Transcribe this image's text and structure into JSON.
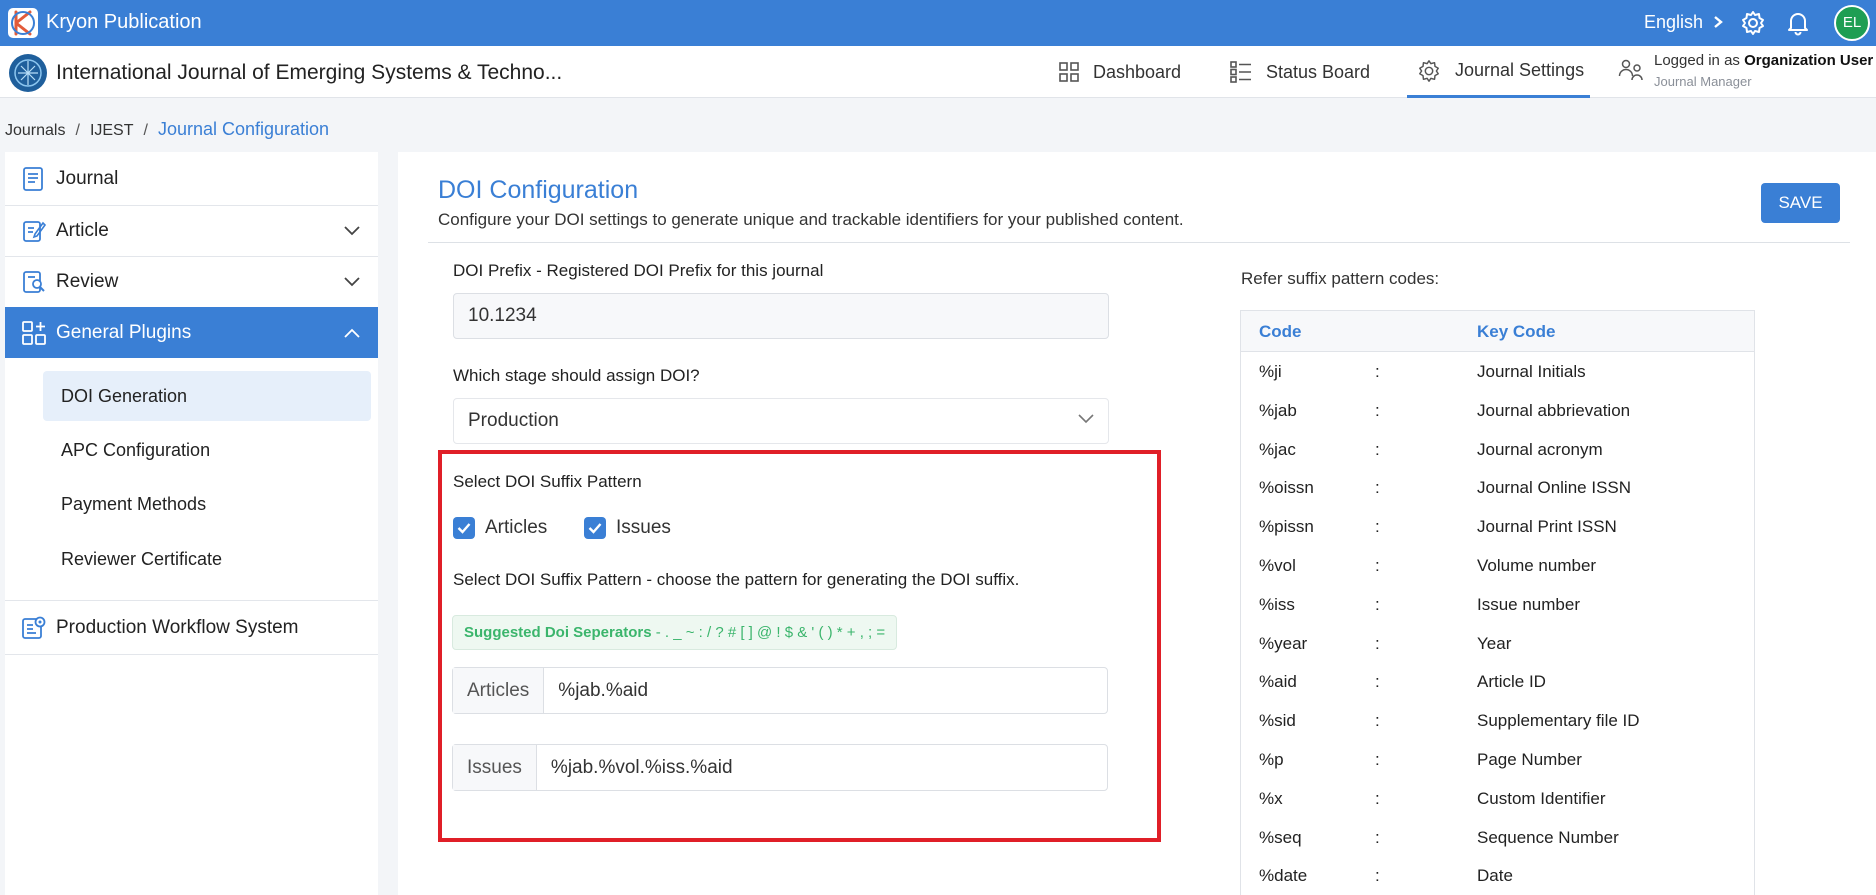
{
  "app": {
    "title": "Kryon Publication",
    "language": "English",
    "avatar_initials": "EL",
    "accent_color": "#3a7fd5"
  },
  "header": {
    "journal_title": "International Journal of Emerging Systems & Techno...",
    "nav": {
      "dashboard": "Dashboard",
      "status_board": "Status Board",
      "journal_settings": "Journal Settings"
    },
    "user": {
      "logged_prefix": "Logged in as",
      "logged_name": "Organization User",
      "role": "Journal Manager"
    }
  },
  "breadcrumb": {
    "journals": "Journals",
    "journal": "IJEST",
    "current": "Journal Configuration"
  },
  "sidebar": {
    "journal": "Journal",
    "article": "Article",
    "review": "Review",
    "general_plugins": "General Plugins",
    "sub": {
      "doi_generation": "DOI Generation",
      "apc_configuration": "APC Configuration",
      "payment_methods": "Payment Methods",
      "reviewer_certificate": "Reviewer Certificate"
    },
    "production": "Production Workflow System"
  },
  "main": {
    "title": "DOI Configuration",
    "subtitle": "Configure your DOI settings to generate unique and trackable identifiers for your published content.",
    "save_label": "SAVE",
    "doi_prefix_label": "DOI Prefix - Registered DOI Prefix for this journal",
    "doi_prefix_value": "10.1234",
    "stage_label": "Which stage should assign DOI?",
    "stage_value": "Production",
    "suffix_pattern_label": "Select DOI Suffix Pattern",
    "checkbox_articles": "Articles",
    "checkbox_issues": "Issues",
    "suffix_pattern_desc": "Select DOI Suffix Pattern - choose the pattern for generating the DOI suffix.",
    "separators_label": "Suggested Doi Seperators",
    "separators_value": " - . _ ~ : / ? # [ ] @ ! $ & ' ( ) * + , ; =",
    "articles_addon": "Articles",
    "articles_value": "%jab.%aid",
    "issues_addon": "Issues",
    "issues_value": "%jab.%vol.%iss.%aid"
  },
  "codes": {
    "refer_label": "Refer suffix pattern codes:",
    "header_code": "Code",
    "header_key": "Key Code",
    "separator": ":",
    "rows": [
      {
        "code": "%ji",
        "key": "Journal Initials"
      },
      {
        "code": "%jab",
        "key": "Journal abbrievation"
      },
      {
        "code": "%jac",
        "key": "Journal acronym"
      },
      {
        "code": "%oissn",
        "key": "Journal Online ISSN"
      },
      {
        "code": "%pissn",
        "key": "Journal Print ISSN"
      },
      {
        "code": "%vol",
        "key": "Volume number"
      },
      {
        "code": "%iss",
        "key": "Issue number"
      },
      {
        "code": "%year",
        "key": "Year"
      },
      {
        "code": "%aid",
        "key": "Article ID"
      },
      {
        "code": "%sid",
        "key": "Supplementary file ID"
      },
      {
        "code": "%p",
        "key": "Page Number"
      },
      {
        "code": "%x",
        "key": "Custom Identifier"
      },
      {
        "code": "%seq",
        "key": "Sequence Number"
      },
      {
        "code": "%date",
        "key": "Date"
      }
    ]
  }
}
